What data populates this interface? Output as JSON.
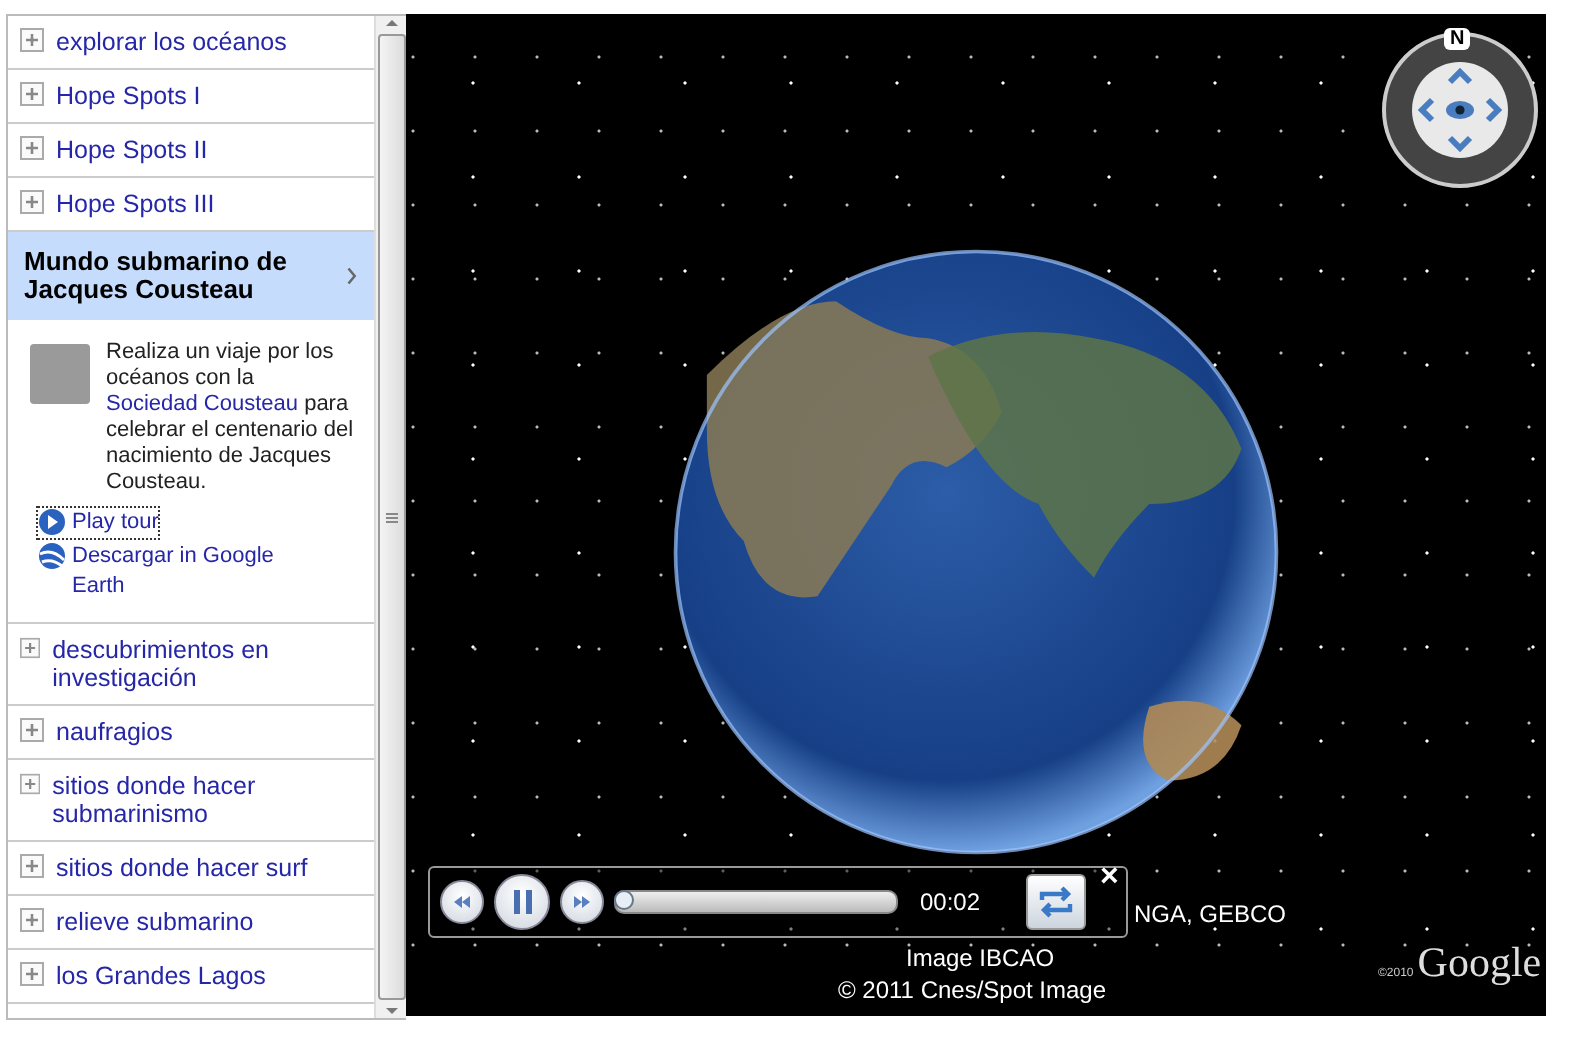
{
  "sidebar": {
    "items": [
      {
        "label": "explorar los océanos",
        "selected": false
      },
      {
        "label": "Hope Spots I",
        "selected": false
      },
      {
        "label": "Hope Spots II",
        "selected": false
      },
      {
        "label": "Hope Spots III",
        "selected": false
      },
      {
        "label": "Mundo submarino de Jacques Cousteau",
        "selected": true,
        "details": {
          "description": [
            {
              "text": "Realiza un viaje por los océanos con la "
            },
            {
              "link": "Sociedad Cousteau"
            },
            {
              "text": " para celebrar el centenario del nacimiento de Jacques Cousteau."
            }
          ],
          "actions": [
            {
              "kind": "play",
              "label": "Play tour",
              "focused": true
            },
            {
              "kind": "download",
              "label": "Descargar in Google Earth",
              "focused": false
            }
          ]
        }
      },
      {
        "label": "descubrimientos en investigación",
        "selected": false
      },
      {
        "label": "naufragios",
        "selected": false
      },
      {
        "label": "sitios donde hacer submarinismo",
        "selected": false
      },
      {
        "label": "sitios donde hacer surf",
        "selected": false
      },
      {
        "label": "relieve submarino",
        "selected": false
      },
      {
        "label": "los Grandes Lagos",
        "selected": false
      }
    ]
  },
  "map": {
    "compass": "N",
    "tour_player": {
      "playing": true,
      "level": 0,
      "time": "00:02",
      "close": "×"
    },
    "attribution": [
      "NGA, GEBCO",
      "Image IBCAO",
      "© 2011 Cnes/Spot Image"
    ],
    "logo": {
      "year": "©2010",
      "name": "Google"
    }
  }
}
